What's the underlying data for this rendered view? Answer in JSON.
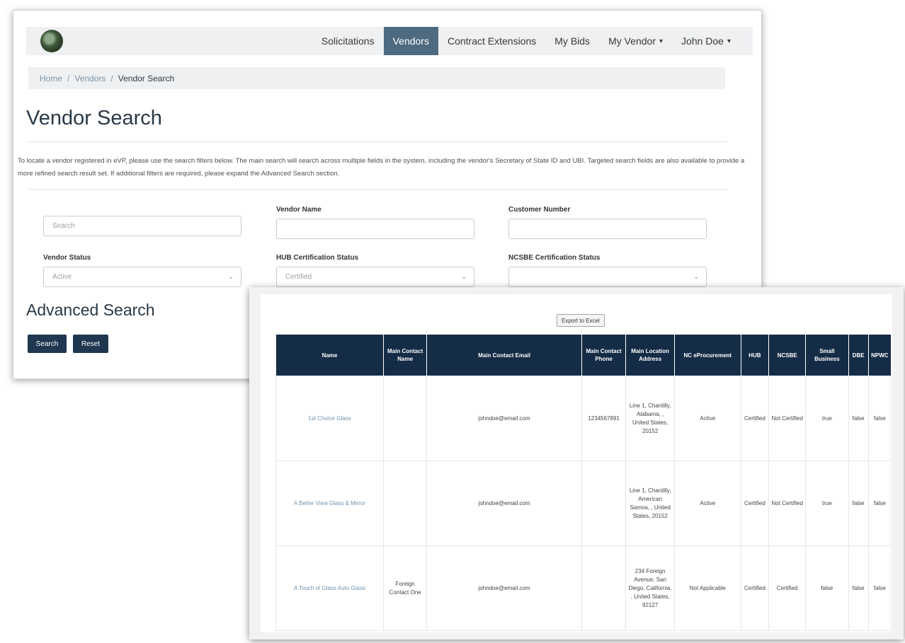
{
  "nav": {
    "items": [
      {
        "label": "Solicitations",
        "active": false,
        "caret": ""
      },
      {
        "label": "Vendors",
        "active": true,
        "caret": ""
      },
      {
        "label": "Contract Extensions",
        "active": false,
        "caret": ""
      },
      {
        "label": "My Bids",
        "active": false,
        "caret": ""
      },
      {
        "label": "My Vendor",
        "active": false,
        "caret": "▾"
      },
      {
        "label": "John Doe",
        "active": false,
        "caret": "▾"
      }
    ]
  },
  "breadcrumb": {
    "home": "Home",
    "sep1": "/",
    "vendors": "Vendors",
    "sep2": "/",
    "current": "Vendor Search"
  },
  "page_title": "Vendor Search",
  "intro": "To locate a vendor registered in eVP, please use the search filters below. The main search will search across multiple fields in the system, including the vendor's Secretary of State ID and UBI. Targeted search fields are also available to provide a more refined search result set. If additional filters are required, please expand the Advanced Search section.",
  "form": {
    "search_placeholder": "Search",
    "vendor_name_label": "Vendor Name",
    "customer_number_label": "Customer Number",
    "vendor_status_label": "Vendor Status",
    "vendor_status_value": "Active",
    "hub_label": "HUB Certification Status",
    "hub_value": "Certified",
    "ncsbe_label": "NCSBE Certification Status",
    "ncsbe_value": ""
  },
  "advanced_search": "Advanced Search",
  "buttons": {
    "search": "Search",
    "reset": "Reset",
    "export": "Export to Excel"
  },
  "table": {
    "headers": [
      "Name",
      "Main Contact Name",
      "Main Contact Email",
      "Main Contact Phone",
      "Main Location Address",
      "NC eProcurement",
      "HUB",
      "NCSBE",
      "Small Business",
      "DBE",
      "NPWC"
    ],
    "rows": [
      {
        "name": "1st Choice Glass",
        "contact_name": "",
        "email": "johndoe@email.com",
        "phone": "1234567891",
        "address": "Line 1, Chantilly, Alabama, , United States, 20152",
        "eproc": "Active",
        "hub": "Certified",
        "ncsbe": "Not Certified",
        "small": "true",
        "dbe": "false",
        "npwc": "false"
      },
      {
        "name": "A Better View Glass & Mirror",
        "contact_name": "",
        "email": "johndoe@email.com",
        "phone": "",
        "address": "Line 1, Chantilly, American Samoa, , United States, 20152",
        "eproc": "Active",
        "hub": "Certified",
        "ncsbe": "Not Certified",
        "small": "true",
        "dbe": "false",
        "npwc": "false"
      },
      {
        "name": "A Touch of Glass Auto Glass",
        "contact_name": "Foreign Contact One",
        "email": "johndoe@email.com",
        "phone": "",
        "address": "234 Foreign Avenue, San Diego, California, , United States, 92127",
        "eproc": "Not Applicable",
        "hub": "Certified",
        "ncsbe": "Certified",
        "small": "false",
        "dbe": "false",
        "npwc": "false"
      }
    ]
  }
}
